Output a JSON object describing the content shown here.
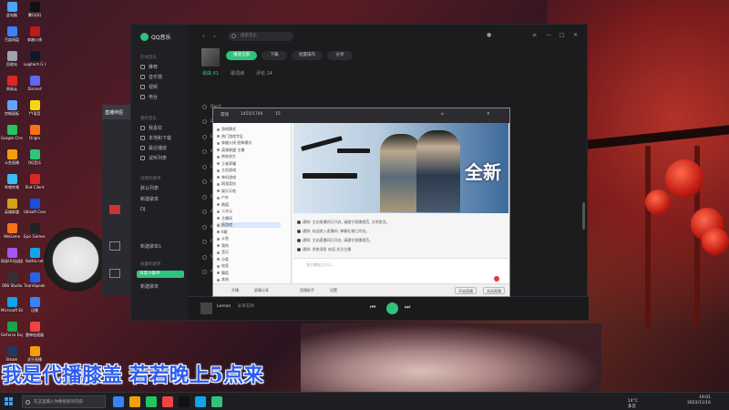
{
  "desktop": {
    "icons": [
      {
        "label": "此电脑",
        "color": "#4aa3ff"
      },
      {
        "label": "百度网盘",
        "color": "#3b82f6"
      },
      {
        "label": "回收站",
        "color": "#9ca3af"
      },
      {
        "label": "网易云",
        "color": "#dc2626"
      },
      {
        "label": "控制面板",
        "color": "#60a5fa"
      },
      {
        "label": "Google Chrome",
        "color": "#22c55e"
      },
      {
        "label": "斗鱼直播",
        "color": "#f59e0b"
      },
      {
        "label": "哔哩哔哩",
        "color": "#38bdf8"
      },
      {
        "label": "英雄联盟",
        "color": "#d4a017"
      },
      {
        "label": "WeGame",
        "color": "#f97316"
      },
      {
        "label": "网易UU加速器",
        "color": "#a855f7"
      },
      {
        "label": "OBS Studio",
        "color": "#333333"
      },
      {
        "label": "Microsoft Edge",
        "color": "#0ea5e9"
      },
      {
        "label": "GeForce Experience",
        "color": "#16a34a"
      },
      {
        "label": "Steam",
        "color": "#1e3a5f"
      },
      {
        "label": "腾讯QQ",
        "color": "#111111"
      },
      {
        "label": "穿越火线",
        "color": "#b91c1c"
      },
      {
        "label": "Logitech G HUB",
        "color": "#0f172a"
      },
      {
        "label": "Discord",
        "color": "#6366f1"
      },
      {
        "label": "YY语音",
        "color": "#f5d90a"
      },
      {
        "label": "Origin",
        "color": "#f97316"
      },
      {
        "label": "QQ音乐",
        "color": "#31c27c"
      },
      {
        "label": "Riot Client",
        "color": "#dc2626"
      },
      {
        "label": "Ubisoft Connect",
        "color": "#1d4ed8"
      },
      {
        "label": "Epic Games Launcher",
        "color": "#222222"
      },
      {
        "label": "Battle.net",
        "color": "#0ea5e9"
      },
      {
        "label": "TeamSpeak",
        "color": "#2563eb"
      },
      {
        "label": "迅雷",
        "color": "#3b82f6"
      },
      {
        "label": "雷神加速器",
        "color": "#ef4444"
      },
      {
        "label": "虎牙直播",
        "color": "#f59e0b"
      }
    ]
  },
  "qqmusic": {
    "logo": "QQ音乐",
    "search_placeholder": "搜索音乐",
    "sidebar": {
      "section1": "在线音乐",
      "items1": [
        "推荐",
        "音乐馆",
        "视频",
        "电台"
      ],
      "section2": "我的音乐",
      "items2": [
        "我喜欢",
        "本地和下载",
        "最近播放",
        "试听列表"
      ],
      "section3": "创建的歌单",
      "items3": [
        "默认列表",
        "新建歌单",
        "DJ",
        "新建歌单1"
      ],
      "section4": "收藏的歌单",
      "active": "日常小歌单",
      "items4": [
        "新建歌单"
      ]
    },
    "actions": {
      "play_all": "播放全部",
      "download": "下载",
      "batch": "批量操作",
      "share": "分享"
    },
    "tabs": [
      "歌曲 61",
      "歌词诗",
      "评论 14"
    ],
    "songs": [
      "Don't",
      "Lo",
      "Ba",
      "Mo",
      "Up",
      "Co",
      "Sa",
      "Al",
      "Wh",
      "Ro",
      "Sh",
      "A Wi"
    ],
    "player": {
      "song": "Lemon",
      "artist": "米津玄師"
    }
  },
  "live": {
    "toolbar": [
      "游戏",
      "1455/1744",
      "15"
    ],
    "tree": [
      "游戏模式",
      "热门游戏专区",
      "穿越火线 经典模式",
      "英雄联盟 主播",
      "绝地求生",
      "王者荣耀",
      "主机游戏",
      "单机游戏",
      "网游竞技",
      "娱乐天地",
      "户外",
      "颜值",
      "二次元",
      "主播间",
      "图游戏",
      "K歌",
      "斗鱼",
      "我的",
      "音乐",
      "分类",
      "电竞",
      "舞蹈",
      "其他"
    ],
    "chat": [
      "通知: 主站直播间已开启, 请遵守直播规范, 文明发言。",
      "通知: 欢迎进入直播间, 弹幕礼物已开启。",
      "通知: 主站直播间已开启, 请遵守直播规范。",
      "通知: 系统消息 欢迎 关注主播"
    ],
    "input_placeholder": "和主播说点什么...",
    "bottom": [
      "开播",
      "屏幕分享",
      "直播助手",
      "设置"
    ],
    "bottom_right": [
      "开始直播",
      "关闭直播"
    ],
    "banner_text": "全新"
  },
  "liveapp": {
    "title": "直播伴侣"
  },
  "subtitle": "我是代播膝盖 若若晚上5点来",
  "taskbar": {
    "search_placeholder": "在这里输入你要搜索的内容",
    "apps": [
      "#3b82f6",
      "#f59e0b",
      "#22c55e",
      "#ef4444",
      "#111111",
      "#0ea5e9",
      "#31c27c"
    ],
    "weather": "14°C 多云",
    "time": "19:01",
    "date": "2022/11/16"
  }
}
